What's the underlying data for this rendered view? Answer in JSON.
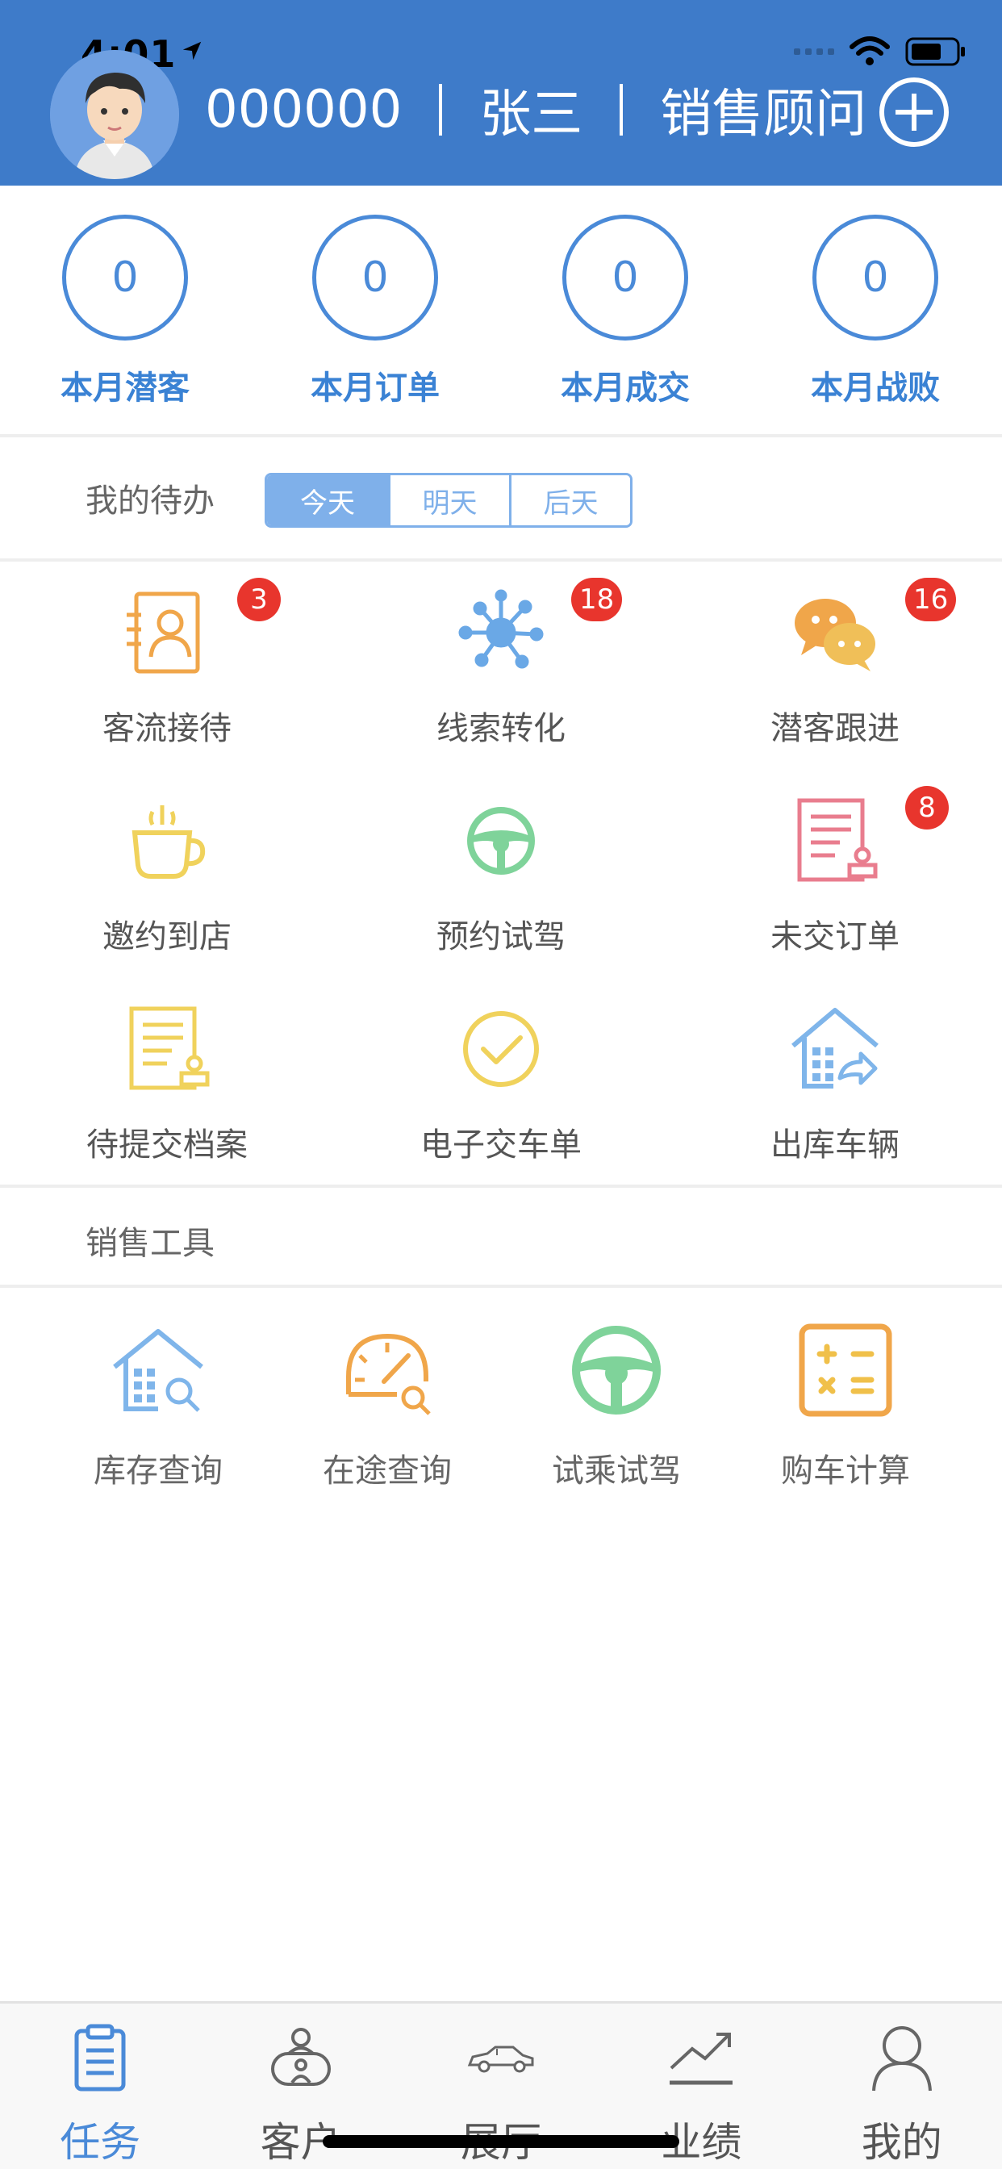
{
  "status_bar": {
    "time": "4:01"
  },
  "header": {
    "user_id": "000000",
    "user_name": "张三",
    "role": "销售顾问"
  },
  "stats": [
    {
      "value": "0",
      "label": "本月潜客"
    },
    {
      "value": "0",
      "label": "本月订单"
    },
    {
      "value": "0",
      "label": "本月成交"
    },
    {
      "value": "0",
      "label": "本月战败"
    }
  ],
  "todo": {
    "title": "我的待办",
    "tabs": [
      "今天",
      "明天",
      "后天"
    ],
    "selected_tab": "今天"
  },
  "tasks": [
    {
      "label": "客流接待",
      "badge": "3",
      "icon": "visitor-card-icon"
    },
    {
      "label": "线索转化",
      "badge": "18",
      "icon": "network-node-icon"
    },
    {
      "label": "潜客跟进",
      "badge": "16",
      "icon": "chat-bubbles-icon"
    },
    {
      "label": "邀约到店",
      "badge": "",
      "icon": "coffee-cup-icon"
    },
    {
      "label": "预约试驾",
      "badge": "",
      "icon": "steering-wheel-icon"
    },
    {
      "label": "未交订单",
      "badge": "8",
      "icon": "order-stamp-icon"
    },
    {
      "label": "待提交档案",
      "badge": "",
      "icon": "document-stamp-icon"
    },
    {
      "label": "电子交车单",
      "badge": "",
      "icon": "check-circle-icon"
    },
    {
      "label": "出库车辆",
      "badge": "",
      "icon": "warehouse-out-icon"
    }
  ],
  "tools": {
    "title": "销售工具",
    "items": [
      {
        "label": "库存查询",
        "icon": "warehouse-search-icon"
      },
      {
        "label": "在途查询",
        "icon": "speedometer-search-icon"
      },
      {
        "label": "试乘试驾",
        "icon": "steering-wheel-icon"
      },
      {
        "label": "购车计算",
        "icon": "calculator-icon"
      }
    ]
  },
  "tabbar": [
    {
      "label": "任务",
      "icon": "clipboard-icon",
      "active": true
    },
    {
      "label": "客户",
      "icon": "customer-icon",
      "active": false
    },
    {
      "label": "展厅",
      "icon": "car-icon",
      "active": false
    },
    {
      "label": "业绩",
      "icon": "trend-chart-icon",
      "active": false
    },
    {
      "label": "我的",
      "icon": "user-icon",
      "active": false
    }
  ],
  "colors": {
    "header_bg": "#3e7bc9",
    "accent": "#4a8ad8",
    "badge": "#e8352d",
    "orange": "#f0a64a",
    "yellow": "#f0d25c",
    "green": "#7fd39a",
    "pink": "#e97d8e",
    "light_blue": "#7fb5ea"
  }
}
